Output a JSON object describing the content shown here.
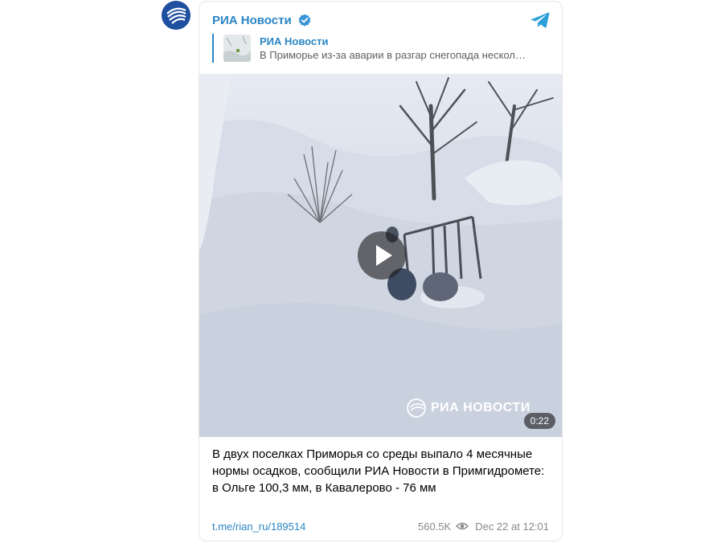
{
  "channel": {
    "name": "РИА Новости"
  },
  "reply": {
    "title": "РИА Новости",
    "body": "В Приморье из-за аварии в разгар снегопада нескол…"
  },
  "video": {
    "duration": "0:22",
    "watermark": "РИА НОВОСТИ"
  },
  "post": {
    "text": "В двух поселках Приморья со среды выпало 4 месячные нормы осадков, сообщили РИА Новости в Примгидромете: в Ольге 100,3 мм, в Кавалерово - 76 мм",
    "link": "t.me/rian_ru/189514",
    "views": "560.5K",
    "date": "Dec 22 at 12:01"
  },
  "colors": {
    "accent": "#2a85c6",
    "avatar": "#1f4fa0"
  },
  "icons": [
    "verified-icon",
    "telegram-icon",
    "play-icon",
    "eye-icon",
    "ria-logo-icon"
  ]
}
